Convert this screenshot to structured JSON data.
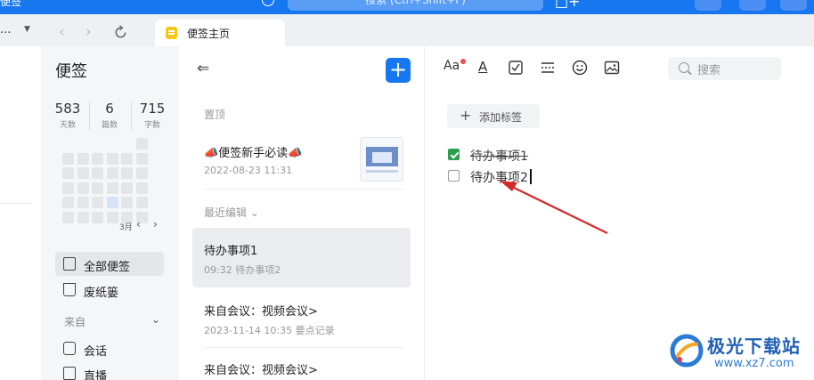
{
  "titlebar": {
    "app_name": "便签",
    "search_placeholder": "搜索 (Ctrl+Shift+F)"
  },
  "tabstrip": {
    "left_menu": "...",
    "tab_label": "便签主页"
  },
  "sidebar": {
    "title": "便签",
    "stats": [
      {
        "value": "583",
        "label": "天数"
      },
      {
        "value": "6",
        "label": "篇数"
      },
      {
        "value": "715",
        "label": "字数"
      }
    ],
    "calendar_month": "3月",
    "items": [
      {
        "label": "全部便签",
        "icon": "note-edit-icon",
        "active": true
      },
      {
        "label": "废纸篓",
        "icon": "trash-icon",
        "active": false
      }
    ],
    "section_label": "来自",
    "source_items": [
      {
        "label": "会话",
        "icon": "chat-icon"
      },
      {
        "label": "直播",
        "icon": "live-icon"
      }
    ]
  },
  "notes_list": {
    "pinned_label": "置顶",
    "recent_label": "最近编辑",
    "pinned": {
      "title": "📣便签新手必读📣",
      "meta": "2022-08-23 11:31"
    },
    "notes": [
      {
        "title": "待办事项1",
        "meta": "09:32 待办事项2",
        "selected": true
      },
      {
        "title": "来自会议：视频会议>",
        "meta": "2023-11-14 10:35 要点记录",
        "selected": false
      },
      {
        "title": "来自会议：视频会议>",
        "meta": "",
        "selected": false
      }
    ]
  },
  "editor": {
    "toolbar": [
      "font-size-icon",
      "text-color-icon",
      "checkbox-icon",
      "divider-icon",
      "emoji-icon",
      "image-icon"
    ],
    "font_size_label": "Aa",
    "text_color_label": "A",
    "search_placeholder": "搜索",
    "add_tag_label": "添加标签",
    "todos": [
      {
        "label": "待办事项1",
        "checked": true
      },
      {
        "label": "待办事项2",
        "checked": false
      }
    ],
    "annotation_arrow_color": "#d42a2a"
  },
  "watermark": {
    "brand": "极光下载站",
    "url": "www.xz7.com"
  },
  "colors": {
    "accent": "#1677f0",
    "check_green": "#2c9d4f"
  }
}
